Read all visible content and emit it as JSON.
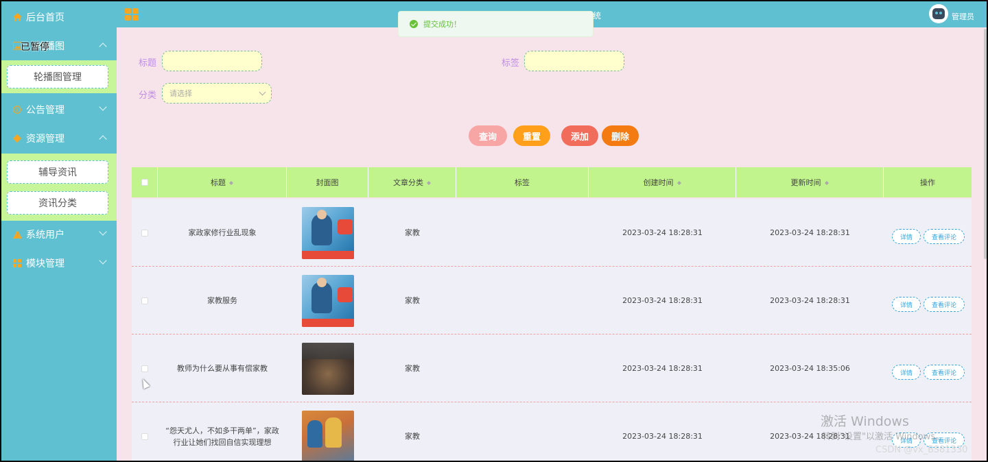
{
  "app": {
    "title": "家政行业资讯网站管理系统",
    "admin": "管理员",
    "paused_label": "已暂停"
  },
  "sidebar": {
    "home": "后台首页",
    "carousel_group": "轮播图",
    "carousel_sub": "轮播图管理",
    "notice": "公告管理",
    "resource": "资源管理",
    "resource_sub": [
      "辅导资讯",
      "资讯分类"
    ],
    "users": "系统用户",
    "modules": "模块管理"
  },
  "toast": {
    "message": "提交成功！"
  },
  "search": {
    "title_label": "标题",
    "tag_label": "标签",
    "category_label": "分类",
    "category_placeholder": "请选择"
  },
  "buttons": {
    "query": "查询",
    "reset": "重置",
    "add": "添加",
    "delete": "删除"
  },
  "table": {
    "headers": {
      "title": "标题",
      "cover": "封面图",
      "category": "文章分类",
      "tags": "标签",
      "created": "创建时间",
      "updated": "更新时间",
      "actions": "操作"
    },
    "action_labels": {
      "detail": "详情",
      "comments": "查看评论"
    },
    "rows": [
      {
        "title": "家政家修行业乱现象",
        "category": "家教",
        "tags": "",
        "created": "2023-03-24 18:28:31",
        "updated": "2023-03-24 18:28:31"
      },
      {
        "title": "家教服务",
        "category": "家教",
        "tags": "",
        "created": "2023-03-24 18:28:31",
        "updated": "2023-03-24 18:28:31"
      },
      {
        "title": "教师为什么要从事有偿家教",
        "category": "家教",
        "tags": "",
        "created": "2023-03-24 18:28:31",
        "updated": "2023-03-24 18:35:06"
      },
      {
        "title": "“怨天尤人，不如多干两单”，家政行业让她们找回自信实现理想",
        "category": "家教",
        "tags": "",
        "created": "2023-03-24 18:28:31",
        "updated": "2023-03-24 18:28:31"
      }
    ]
  },
  "overlay": {
    "watermark_line1": "激活 Windows",
    "watermark_line2": "转到\"设置\"以激活 Windows。",
    "csdn": "CSDN @vx_BS81330"
  },
  "colors": {
    "sidebar": "#5ec0d1",
    "content_bg": "#f6e4ea",
    "table_header": "#c1f48d",
    "btn_query": "#f8a5a5",
    "btn_reset": "#ff9f1a",
    "btn_add": "#f26c5c",
    "btn_delete": "#f47a12",
    "label_purple": "#c08ee2",
    "toast_green": "#67c23a"
  }
}
